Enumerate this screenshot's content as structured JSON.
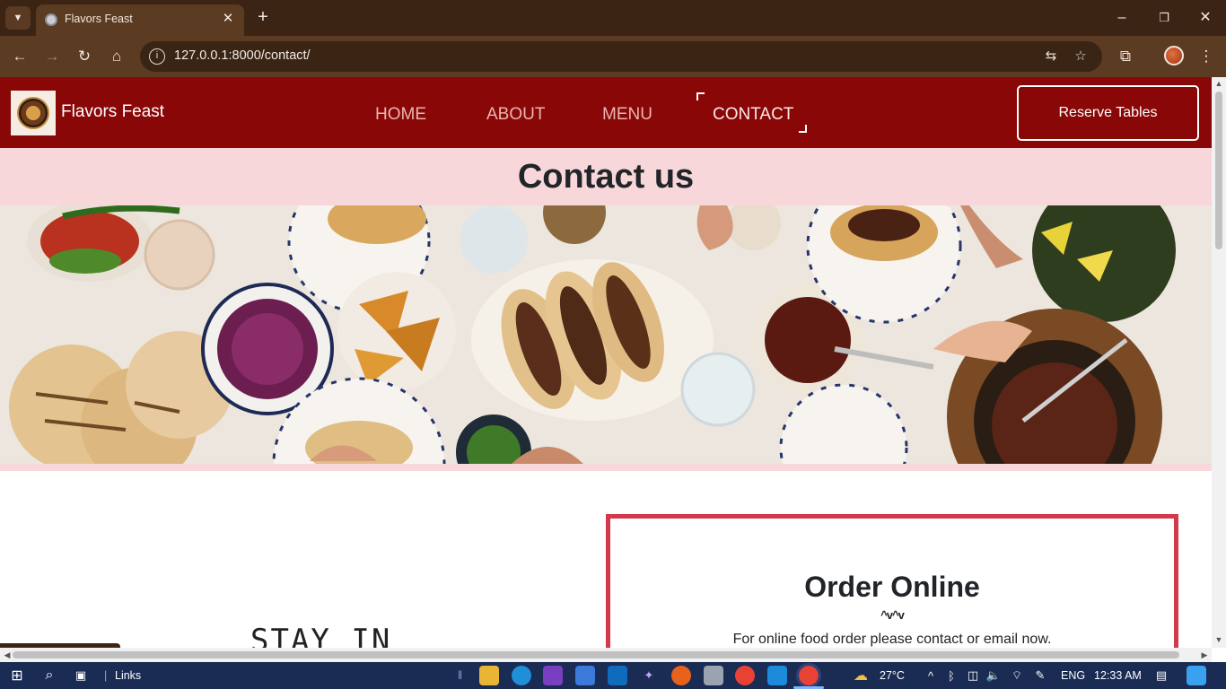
{
  "browser": {
    "tab_title": "Flavors Feast",
    "url": "127.0.0.1:8000/contact/",
    "status_url": "127.0.0.1:8000/contact",
    "new_tab_symbol": "+",
    "close_symbol": "✕"
  },
  "site": {
    "brand": "Flavors Feast",
    "nav": [
      "HOME",
      "ABOUT",
      "MENU",
      "CONTACT"
    ],
    "active_nav": "CONTACT",
    "reserve_label": "Reserve Tables"
  },
  "page": {
    "heading": "Contact us",
    "stay_heading": "STAY IN",
    "order": {
      "title": "Order Online",
      "divider": "^v^v",
      "text": "For online food order please contact or email now."
    }
  },
  "taskbar": {
    "links_label": "Links",
    "weather": "27°C",
    "language": "ENG",
    "time": "12:33 AM"
  },
  "colors": {
    "nav_bg": "#8a0707",
    "band_bg": "#f8d7da",
    "order_border": "#d3394c",
    "browser_frame": "#3b2414",
    "taskbar": "#1a2b54"
  }
}
